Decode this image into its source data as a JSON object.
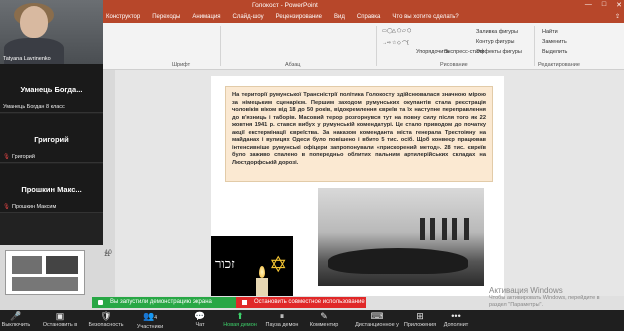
{
  "window": {
    "title": "Голокост - PowerPoint",
    "min": "—",
    "max": "□",
    "close": "✕"
  },
  "ribbon_tabs": [
    "Конструктор",
    "Переходы",
    "Анимация",
    "Слайд-шоу",
    "Рецензирование",
    "Вид",
    "Справка",
    "Что вы хотите сделать?"
  ],
  "ribbon": {
    "groups": {
      "font": "Шрифт",
      "paragraph": "Абзац",
      "drawing": "Рисование",
      "editing": "Редактирование"
    },
    "drawing_items": [
      "Упорядочить",
      "Экспресс-стили",
      "Заливка фигуры",
      "Контур фигуры",
      "Эффекты фигуры"
    ],
    "editing_items": [
      "Найти",
      "Заменить",
      "Выделить"
    ]
  },
  "participants": [
    {
      "name": "",
      "label": "Tatyana Lavrinenko",
      "video": true
    },
    {
      "name": "Уманець Богда...",
      "label": "Уманець Богдан 8 класс"
    },
    {
      "name": "Григорий",
      "label": "Григорий",
      "muted": true
    },
    {
      "name": "Прошкин Макс...",
      "label": "Прошкин Максим",
      "muted": true
    }
  ],
  "thumbnails": [
    {
      "num": "10"
    },
    {
      "num": "11"
    }
  ],
  "slide": {
    "text": "На території румунської Трансністрії політика Голокосту здійснювалася значною мірою за німецьким сценарієм. Першим заходом румунських окупантів стала реєстрація чоловіків віком від 18 до 50 років, відокремлення євреїв та їх наступне переправлення до в'язниць і таборів. Масовий терор розгорнувся тут на повну силу після того як 22 жовтня 1941 р. стався вибух у румунській комендатурі. Це стало приводом до початку акції екстермінації євреїства. За наказом коменданта міста генерала Трестоіяну на майданах і вулицях Одеси було повішено і вбито 5 тис. осіб. Щоб конвеєр працював інтенсивніше румунські офіцери запропонували «прискорений метод». 28 тис. євреїв було заживо спалено в попередньо облитих пальним артилерійських складах на Люстдорфській дорозі.",
    "candle_word": "זכור"
  },
  "notices": {
    "green": "Вы запустили демонстрацию экрана",
    "red": "Остановить совместное использование"
  },
  "watermark": {
    "line1": "Активация Windows",
    "line2": "Чтобы активировать Windows, перейдите в",
    "line3": "раздел \"Параметры\"."
  },
  "toolbar": [
    {
      "label": "Выключить",
      "icon": "🎤"
    },
    {
      "label": "Остановить в",
      "icon": "▣"
    },
    {
      "label": "Безопасность",
      "icon": "🛡"
    },
    {
      "label": "Участники",
      "icon": "👥",
      "count": "4"
    },
    {
      "label": "Чат",
      "icon": "💬"
    },
    {
      "label": "Новая демон",
      "icon": "⬆"
    },
    {
      "label": "Пауза демон",
      "icon": "⏸"
    },
    {
      "label": "Комментир",
      "icon": "✎"
    },
    {
      "label": "Дистанционное у",
      "icon": "⌨"
    },
    {
      "label": "Приложения",
      "icon": "⊞"
    },
    {
      "label": "Дополнит",
      "icon": "•••"
    }
  ]
}
